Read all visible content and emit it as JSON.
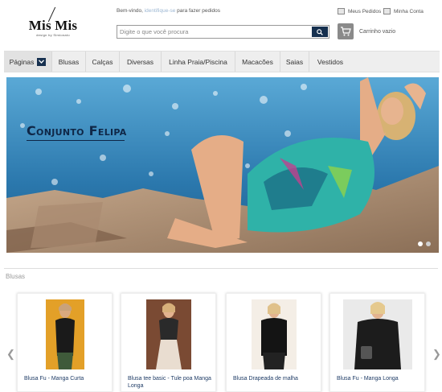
{
  "logo": {
    "name": "Mis Mis",
    "tagline": "design by Simionato"
  },
  "header": {
    "welcome_prefix": "Bem-vindo,",
    "welcome_link": "identifique-se",
    "welcome_suffix": "para fazer pedidos",
    "search_placeholder": "Digite o que você procura",
    "my_orders": "Meus Pedidos",
    "my_account": "Minha Conta",
    "cart_label": "Carrinho vazio"
  },
  "nav": {
    "items": [
      "Páginas",
      "Blusas",
      "Calças",
      "Diversas",
      "Linha Praia/Piscina",
      "Macacões",
      "Saias",
      "Vestidos"
    ]
  },
  "banner": {
    "title": "Conjunto Felipa",
    "slide_count": 2,
    "active_slide": 1
  },
  "section": {
    "title": "Blusas",
    "products": [
      {
        "name": "Blusa Fu - Manga Curta"
      },
      {
        "name": "Blusa tee basic - Tule poa Manga Longa"
      },
      {
        "name": "Blusa Drapeada de malha"
      },
      {
        "name": "Blusa Fu - Manga Longa"
      }
    ]
  },
  "colors": {
    "nav_bg": "#eeeeee",
    "accent_dark": "#16304f",
    "product_link": "#1f3c66"
  },
  "icons": [
    "search-icon",
    "chevron-down-icon",
    "cart-icon",
    "arrow-left-icon",
    "arrow-right-icon"
  ]
}
